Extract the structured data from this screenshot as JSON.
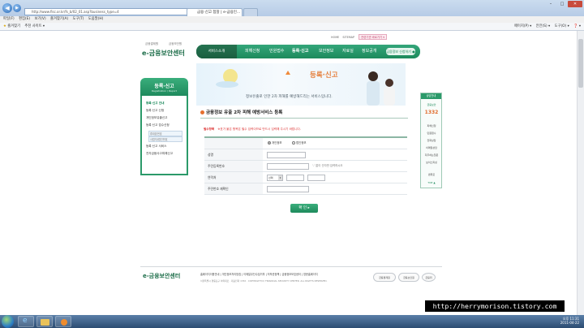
{
  "browser": {
    "address": "http://www.fisc.or.kr/fs_b/02_01.asp?business_type=4",
    "tab_active": "금융·신고 접찰 | e-금융인...",
    "tab_new": "",
    "window_buttons": [
      "–",
      "□",
      "✕"
    ],
    "menu": [
      "파일(F)",
      "편집(E)",
      "보기(V)",
      "즐겨찾기(A)",
      "도구(T)",
      "도움말(H)"
    ],
    "favorites": [
      "즐겨찾기",
      "추천 사이트 ▾"
    ],
    "toolbar_right": [
      "페이지(P) ▾",
      "안전(S) ▾",
      "도구(O) ▾",
      "❓ ▾"
    ]
  },
  "site": {
    "logo_small_left": "금융결제원",
    "logo_small_right": "금융보안원",
    "logo_text": "e-금융보안센터",
    "util_links": [
      "HOME",
      "SITEMAP"
    ],
    "util_select": "관련기관 바로가기 ▾",
    "gnb_home": "서비스소개",
    "gnb_items": [
      "피해신청",
      "민원접수",
      "등록·신고",
      "보안정보",
      "자료실",
      "정보공개"
    ],
    "gnb_button": "금융정보 신청하기 ●",
    "visual_title": "등록·신고",
    "visual_sub": "정보유출로 인한 2차 피해를 예방해드리는 서비스입니다."
  },
  "sidebar": {
    "title": "등록·신고",
    "subtitle": "Registration / Report",
    "items": [
      {
        "label": "등록·신고 안내"
      },
      {
        "label": "등록·신고 신청"
      },
      {
        "label": "개인정보유출신고"
      },
      {
        "label": "등록·신고 접수신청"
      },
      {
        "label": "등록·신고 서비스"
      },
      {
        "label": "전자금융사고피해신고"
      }
    ],
    "subs": [
      "휴대폰번호",
      "사업자/법인번호"
    ]
  },
  "content": {
    "title": "금융정보 유출 2차 피해 예방서비스 등록",
    "required_label": "필수항목",
    "required_note": "※표가 붙은 항목은 필수 입력이므로 반드시 입력해 주시기 바랍니다.",
    "rows": [
      {
        "label": "",
        "radio1": "개인정보",
        "radio2": "법인정보"
      },
      {
        "label": "성명"
      },
      {
        "label": "주민등록번호",
        "hint": "'-' 없이 숫자만 입력하시오"
      },
      {
        "label": "연락처",
        "select": "선택"
      },
      {
        "label": "주민번호 재확인"
      }
    ],
    "confirm": "확 인 ▸"
  },
  "right_banner": {
    "head": "상담안내",
    "line1": "금융보안",
    "number": "1332",
    "items": [
      "피해신청",
      "민원접수",
      "전화상담",
      "이메일상담",
      "자주하는질문",
      "보이스피싱"
    ],
    "top_label": "TOP ▲",
    "bottom": "맨위로"
  },
  "footer": {
    "logo": "e-금융보안센터",
    "links": [
      "홈페이지이용안내",
      "개인정보처리방침",
      "이메일무단수집거부",
      "저작권정책",
      "금융정보보호센터",
      "영문홈페이지"
    ],
    "address": "서울특별시 영등포구 여의대로 · 대표전화 1332 · COPYRIGHT(C) FINANCIAL SECURITY CENTER. ALL RIGHTS RESERVED.",
    "logos": [
      "금융결제원",
      "금융보안원",
      "금융위"
    ]
  },
  "taskbar": {
    "time": "오후 11:31",
    "date": "2011-04-22"
  },
  "watermark": "http://herrymorison.tistory.com"
}
